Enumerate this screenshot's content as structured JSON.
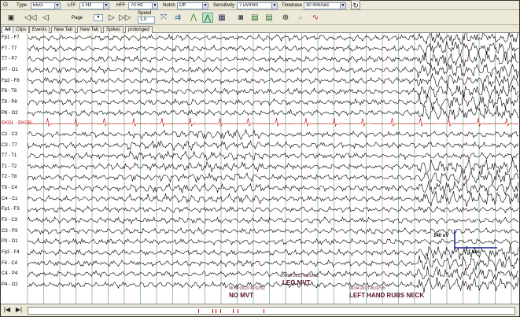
{
  "toolbar1": {
    "type_label": "Type",
    "type_value": "EEG",
    "lff_label": "LFF",
    "lff_value": "1 Hz",
    "hff_label": "HFF",
    "hff_value": "70 Hz",
    "notch_label": "Notch",
    "notch_value": "Off",
    "sensitivity_label": "Sensitivity",
    "sensitivity_value": "7 uV/mm",
    "timebase_label": "Timebase",
    "timebase_value": "30 mm/sec"
  },
  "toolbar2": {
    "page_label": "Page",
    "speed_label": "Speed",
    "speed_value": "1.0"
  },
  "tabs": [
    "All",
    "Clips",
    "Events",
    "New Tab",
    "New Tab",
    "Spikes",
    "prolonged"
  ],
  "channels": [
    "Fp1 - F7",
    "F7 - T7",
    "T7 - P7",
    "P7 - O1",
    "Fp2 - F8",
    "F8 - T8",
    "T8 - P8",
    "P8 - O2",
    "EKGL - EKGR",
    "Cz - C3",
    "C3 - T7",
    "T7 - T1",
    "T1 - T2",
    "T2 - T8",
    "T8 - C4",
    "C4 - Cz",
    "Fp1 - F3",
    "F3 - C3",
    "C3 - P3",
    "P3 - O1",
    "Fp2 - F4",
    "F4 - C4",
    "C4 - P4",
    "P4 - O2"
  ],
  "annotations": [
    {
      "time": "06:04:2013 06:02:02",
      "text": "NO MVT"
    },
    {
      "time": "06:04:2013 06:02:03",
      "text": "LEG MVT"
    },
    {
      "time": "06:04:2013 06:02:05",
      "text": "LEFT HAND RUBS NECK"
    }
  ],
  "scale": {
    "amplitude": "140 uV",
    "time": "1 sec"
  },
  "colors": {
    "trace": "#000000",
    "ekg": "#c00000",
    "grid": "#2e8b2e",
    "annotation": "#5a1030",
    "scale_bar": "#1a1aa0"
  }
}
